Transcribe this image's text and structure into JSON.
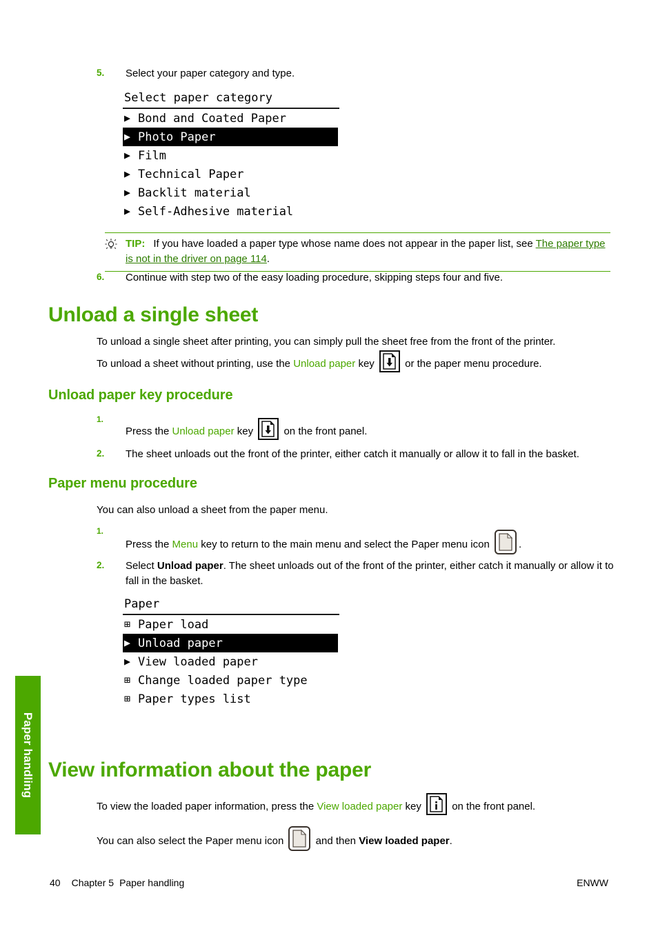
{
  "document": {
    "page_number": "40",
    "chapter": "Chapter 5",
    "chapter_title": "Paper handling",
    "locale_code": "ENWW",
    "side_tab_label": "Paper handling",
    "accent_color": "#4CA800",
    "link_color": "#2E7D00"
  },
  "steps_top": {
    "step5": {
      "number": "5.",
      "text": "Select your paper category and type."
    },
    "step6": {
      "number": "6.",
      "text": "Continue with step two of the easy loading procedure, skipping steps four and five."
    }
  },
  "paper_category_menu": {
    "title": "Select paper category",
    "items": [
      {
        "glyph": "▶",
        "label": "Bond and Coated Paper",
        "selected": false
      },
      {
        "glyph": "▶",
        "label": "Photo Paper",
        "selected": true
      },
      {
        "glyph": "▶",
        "label": "Film",
        "selected": false
      },
      {
        "glyph": "▶",
        "label": "Technical Paper",
        "selected": false
      },
      {
        "glyph": "▶",
        "label": "Backlit material",
        "selected": false
      },
      {
        "glyph": "▶",
        "label": "Self-Adhesive material",
        "selected": false
      }
    ]
  },
  "tip": {
    "icon": "lightbulb-icon",
    "label": "TIP:",
    "text_before": "If you have loaded a paper type whose name does not appear in the paper list, see ",
    "link_text": "The paper type is not in the driver on page 114",
    "text_after": "."
  },
  "unload_single_sheet": {
    "heading": "Unload a single sheet",
    "para1": "To unload a single sheet after printing, you can simply pull the sheet free from the front of the printer.",
    "para2_before": "To unload a sheet without printing, use the ",
    "para2_key": "Unload paper",
    "para2_mid": " key ",
    "para2_after": " or the paper menu procedure."
  },
  "unload_key_procedure": {
    "heading": "Unload paper key procedure",
    "step1": {
      "number": "1.",
      "before": "Press the ",
      "key": "Unload paper",
      "mid": " key ",
      "after": " on the front panel."
    },
    "step2": {
      "number": "2.",
      "text": "The sheet unloads out the front of the printer, either catch it manually or allow it to fall in the basket."
    }
  },
  "paper_menu_procedure": {
    "heading": "Paper menu procedure",
    "intro": "You can also unload a sheet from the paper menu.",
    "step1": {
      "number": "1.",
      "before": "Press the ",
      "key": "Menu",
      "mid": " key to return to the main menu and select the Paper menu icon ",
      "after": "."
    },
    "step2": {
      "number": "2.",
      "before": "Select ",
      "bold": "Unload paper",
      "after": ". The sheet unloads out of the front of the printer, either catch it manually or allow it to fall in the basket."
    }
  },
  "paper_menu": {
    "title": "Paper",
    "items": [
      {
        "glyph": "⊞",
        "label": "Paper load",
        "selected": false
      },
      {
        "glyph": "▶",
        "label": "Unload paper",
        "selected": true
      },
      {
        "glyph": "▶",
        "label": "View loaded paper",
        "selected": false
      },
      {
        "glyph": "⊞",
        "label": "Change loaded paper type",
        "selected": false
      },
      {
        "glyph": "⊞",
        "label": "Paper types list",
        "selected": false
      }
    ]
  },
  "view_information": {
    "heading": "View information about the paper",
    "para1_before": "To view the loaded paper information, press the ",
    "para1_key": "View loaded paper",
    "para1_mid": " key ",
    "para1_after": " on the front panel.",
    "para2_before": "You can also select the Paper menu icon ",
    "para2_mid": " and then ",
    "para2_bold": "View loaded paper",
    "para2_after": "."
  }
}
